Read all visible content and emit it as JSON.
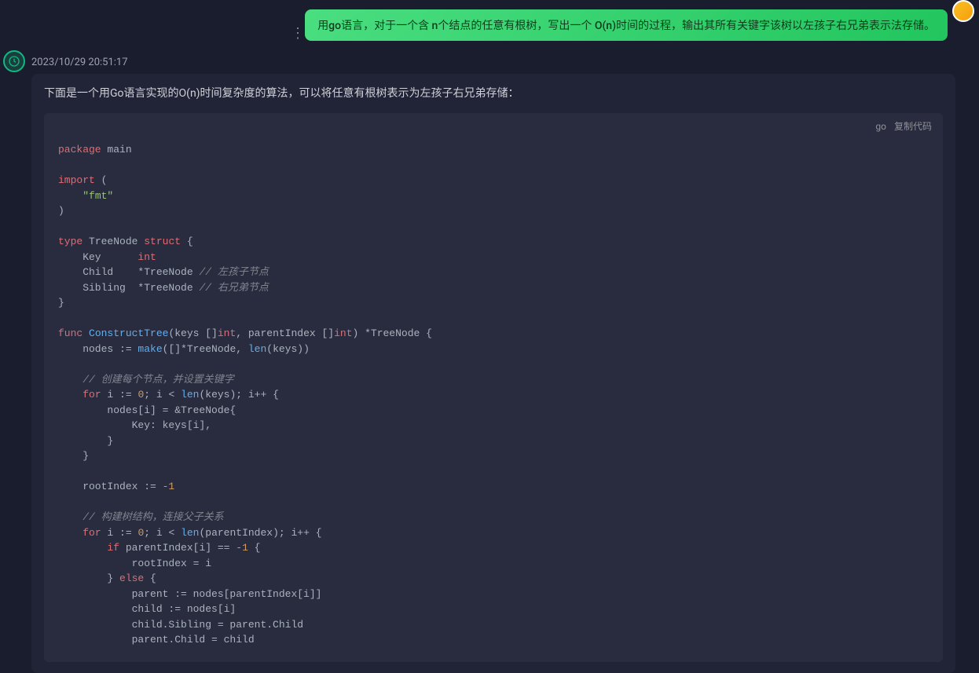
{
  "user_message": "用go语言，对于一个含 n个结点的任意有根树，写出一个 O(n)时间的过程，输出其所有关键字该树以左孩子右兄弟表示法存储。",
  "timestamp": "2023/10/29 20:51:17",
  "intro_text": "下面是一个用Go语言实现的O(n)时间复杂度的算法，可以将任意有根树表示为左孩子右兄弟存储：",
  "code_lang": "go",
  "copy_label": "复制代码",
  "code": {
    "line1_kw": "package",
    "line1_name": " main",
    "line3_kw": "import",
    "line3_paren": " (",
    "line4_str": "\"fmt\"",
    "line5": ")",
    "line7_kw": "type",
    "line7_name": " TreeNode ",
    "line7_kw2": "struct",
    "line7_brace": " {",
    "line8": "    Key      ",
    "line8_type": "int",
    "line9": "    Child    *TreeNode ",
    "line9_comment": "// 左孩子节点",
    "line10": "    Sibling  *TreeNode ",
    "line10_comment": "// 右兄弟节点",
    "line11": "}",
    "line13_kw": "func",
    "line13_name": " ConstructTree",
    "line13_params": "(keys []",
    "line13_type1": "int",
    "line13_params2": ", parentIndex []",
    "line13_type2": "int",
    "line13_params3": ") *TreeNode {",
    "line14": "    nodes := ",
    "line14_fn": "make",
    "line14_rest": "([]*TreeNode, ",
    "line14_fn2": "len",
    "line14_rest2": "(keys))",
    "line16_comment": "// 创建每个节点，并设置关键字",
    "line17_kw": "for",
    "line17_rest": " i := ",
    "line17_num": "0",
    "line17_rest2": "; i < ",
    "line17_fn": "len",
    "line17_rest3": "(keys); i++ {",
    "line18": "        nodes[i] = &TreeNode{",
    "line19": "            Key: keys[i],",
    "line20": "        }",
    "line21": "    }",
    "line23": "    rootIndex := ",
    "line23_num": "-1",
    "line25_comment": "// 构建树结构，连接父子关系",
    "line26_kw": "for",
    "line26_rest": " i := ",
    "line26_num": "0",
    "line26_rest2": "; i < ",
    "line26_fn": "len",
    "line26_rest3": "(parentIndex); i++ {",
    "line27_kw": "if",
    "line27_rest": " parentIndex[i] == ",
    "line27_num": "-1",
    "line27_brace": " {",
    "line28": "            rootIndex = i",
    "line29": "        } ",
    "line29_kw": "else",
    "line29_brace": " {",
    "line30": "            parent := nodes[parentIndex[i]]",
    "line31": "            child := nodes[i]",
    "line32": "            child.Sibling = parent.Child",
    "line33": "            parent.Child = child"
  }
}
